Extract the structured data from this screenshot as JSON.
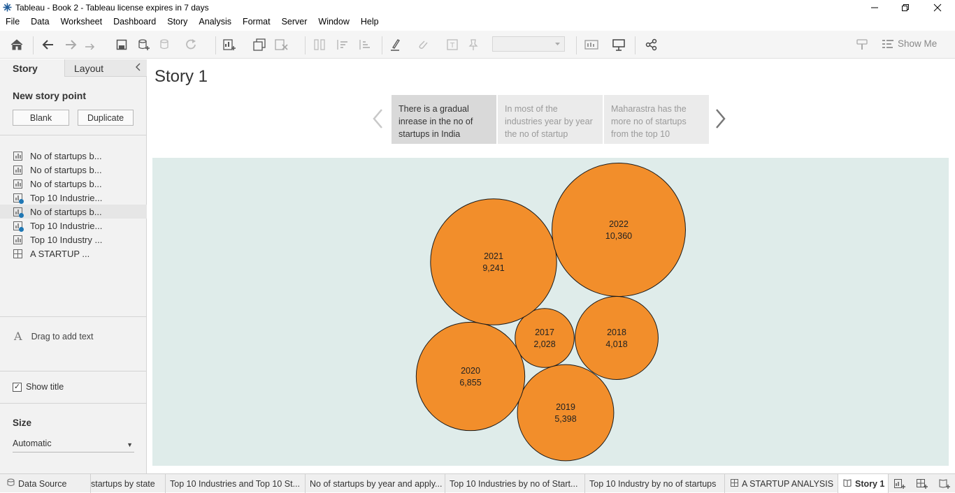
{
  "window": {
    "title": "Tableau - Book 2 - Tableau license expires in 7 days"
  },
  "menu": [
    "File",
    "Data",
    "Worksheet",
    "Dashboard",
    "Story",
    "Analysis",
    "Format",
    "Server",
    "Window",
    "Help"
  ],
  "toolbar": {
    "show_me_label": "Show Me"
  },
  "left_pane": {
    "tab_story": "Story",
    "tab_layout": "Layout",
    "new_story_point_label": "New story point",
    "blank_button": "Blank",
    "duplicate_button": "Duplicate",
    "sheets": [
      {
        "label": "No of startups b...",
        "type": "worksheet",
        "used": false
      },
      {
        "label": "No of startups b...",
        "type": "worksheet",
        "used": false
      },
      {
        "label": "No of startups b...",
        "type": "worksheet",
        "used": false
      },
      {
        "label": "Top 10 Industrie...",
        "type": "worksheet",
        "used": true
      },
      {
        "label": "No of startups b...",
        "type": "worksheet",
        "used": true
      },
      {
        "label": "Top 10 Industrie...",
        "type": "worksheet",
        "used": true
      },
      {
        "label": "Top 10 Industry ...",
        "type": "worksheet",
        "used": false
      },
      {
        "label": "A STARTUP ...",
        "type": "dashboard",
        "used": false
      }
    ],
    "drag_text": "Drag to add text",
    "show_title_label": "Show title",
    "show_title_checked": true,
    "size_label": "Size",
    "size_value": "Automatic"
  },
  "story": {
    "title": "Story 1",
    "points": [
      {
        "text": "There is a gradual inrease in the no of startups in India",
        "active": true
      },
      {
        "text": "In most of the industries year by year the no of startup",
        "active": false
      },
      {
        "text": "Maharastra has the more no of startups from the top 10",
        "active": false
      }
    ]
  },
  "chart_data": {
    "type": "packed-bubble",
    "color": "#f28e2b",
    "background": "#dfecea",
    "bubbles": [
      {
        "year": "2017",
        "value": 2028,
        "value_label": "2,028"
      },
      {
        "year": "2018",
        "value": 4018,
        "value_label": "4,018"
      },
      {
        "year": "2019",
        "value": 5398,
        "value_label": "5,398"
      },
      {
        "year": "2020",
        "value": 6855,
        "value_label": "6,855"
      },
      {
        "year": "2021",
        "value": 9241,
        "value_label": "9,241"
      },
      {
        "year": "2022",
        "value": 10360,
        "value_label": "10,360"
      }
    ]
  },
  "bottom_tabs": [
    {
      "label": "Data Source",
      "icon": "database-icon",
      "active": false
    },
    {
      "label": "startups by state",
      "icon": "",
      "active": false
    },
    {
      "label": "Top 10 Industries and Top 10 St...",
      "icon": "",
      "active": false
    },
    {
      "label": "No of startups by year and apply...",
      "icon": "",
      "active": false
    },
    {
      "label": "Top 10 Industries by no of Start...",
      "icon": "",
      "active": false
    },
    {
      "label": "Top 10 Industry by no of startups",
      "icon": "",
      "active": false
    },
    {
      "label": "A STARTUP ANALYSIS",
      "icon": "dashboard-icon",
      "active": false
    },
    {
      "label": "Story 1",
      "icon": "story-icon",
      "active": true
    }
  ]
}
